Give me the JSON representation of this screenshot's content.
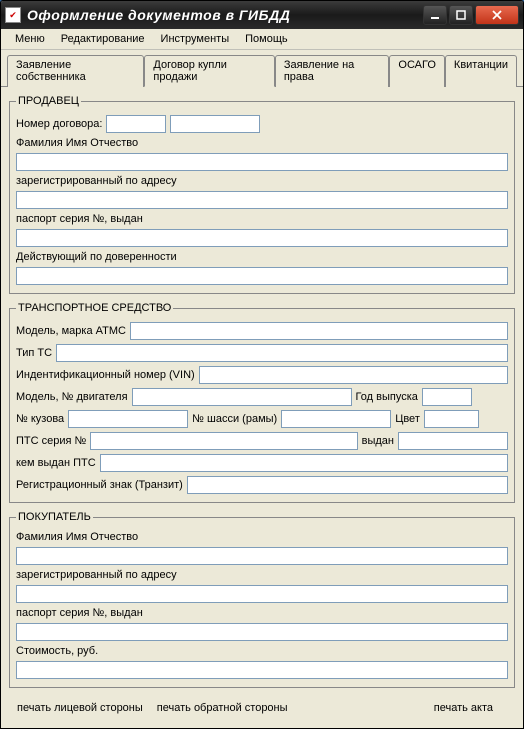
{
  "window": {
    "title": "Оформление документов в ГИБДД"
  },
  "menu": {
    "items": [
      "Меню",
      "Редактирование",
      "Инструменты",
      "Помощь"
    ]
  },
  "tabs": {
    "items": [
      "Заявление собственника",
      "Договор купли продажи",
      "Заявление  на права",
      "ОСАГО",
      "Квитанции"
    ],
    "activeIndex": 1
  },
  "seller": {
    "legend": "ПРОДАВЕЦ",
    "contractNoLabel": "Номер договора:",
    "contractNo1": "",
    "contractNo2": "",
    "fioLabel": "Фамилия Имя Отчество",
    "fio": "",
    "addressLabel": "зарегистрированный по адресу",
    "address": "",
    "passportLabel": "паспорт серия №, выдан",
    "passport": "",
    "proxyLabel": "Действующий по доверенности",
    "proxy": ""
  },
  "vehicle": {
    "legend": "ТРАНСПОРТНОЕ СРЕДСТВО",
    "modelBrandLabel": "Модель, марка АТМС",
    "modelBrand": "",
    "typeLabel": "Тип ТС",
    "type": "",
    "vinLabel": "Индентификационный номер (VIN)",
    "vin": "",
    "engineLabel": "Модель, № двигателя",
    "engine": "",
    "yearLabel": "Год выпуска",
    "year": "",
    "bodyLabel": "№ кузова",
    "body": "",
    "chassisLabel": "№ шасси (рамы)",
    "chassis": "",
    "colorLabel": "Цвет",
    "color": "",
    "ptsSerialLabel": "ПТС серия №",
    "ptsSerial": "",
    "ptsIssuedLabel": "выдан",
    "ptsIssued": "",
    "ptsIssuerLabel": "кем выдан ПТС",
    "ptsIssuer": "",
    "regMarkLabel": "Регистрационный знак (Транзит)",
    "regMark": ""
  },
  "buyer": {
    "legend": "ПОКУПАТЕЛЬ",
    "fioLabel": "Фамилия Имя Отчество",
    "fio": "",
    "addressLabel": "зарегистрированный по адресу",
    "address": "",
    "passportLabel": "паспорт серия №, выдан",
    "passport": "",
    "priceLabel": "Стоимость, руб.",
    "price": ""
  },
  "footer": {
    "printFront": "печать лицевой стороны",
    "printBack": "печать обратной стороны",
    "printAct": "печать акта"
  }
}
